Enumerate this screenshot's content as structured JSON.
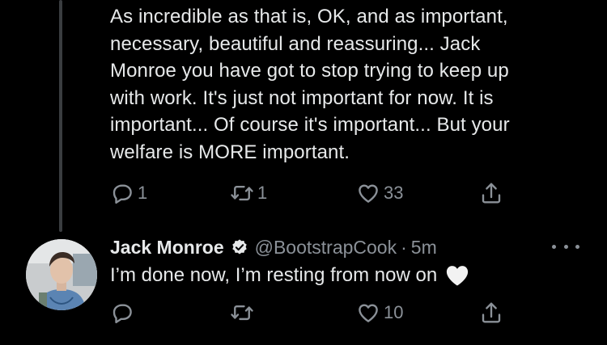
{
  "first_tweet": {
    "text": "As incredible as that is, OK, and as important,\nnecessary, beautiful and reassuring... Jack\nMonroe you have got to stop trying to keep up\nwith work. It's just not important for now. It is\nimportant... Of course it's important... But your\nwelfare is MORE important.",
    "reply_count": "1",
    "retweet_count": "1",
    "like_count": "33"
  },
  "reply_tweet": {
    "author_name": "Jack Monroe",
    "handle": "@BootstrapCook",
    "separator": "·",
    "time": "5m",
    "text": "I’m done now, I’m resting from now on",
    "emoji": "white-heart",
    "reply_count": "",
    "retweet_count": "",
    "like_count": "10"
  },
  "colors": {
    "background": "#000000",
    "text": "#e7e9ea",
    "muted": "#8b9198",
    "thread_line": "#3a3d40"
  }
}
